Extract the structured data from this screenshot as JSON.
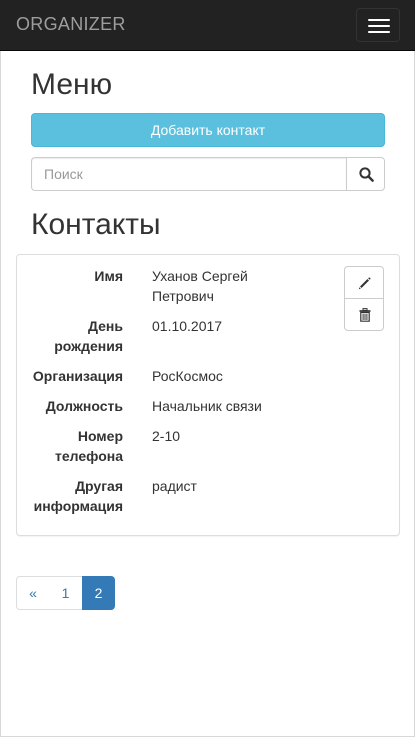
{
  "navbar": {
    "brand": "ORGANIZER",
    "toggle_icon": "hamburger-icon"
  },
  "menu": {
    "title": "Меню",
    "add_button_label": "Добавить контакт",
    "search_placeholder": "Поиск",
    "search_value": "",
    "search_icon": "search-icon"
  },
  "contacts": {
    "title": "Контакты",
    "card": {
      "fields": [
        {
          "label_lines": [
            "Имя"
          ],
          "value_lines": [
            "Уханов Сергей",
            "Петрович"
          ]
        },
        {
          "label_lines": [
            "День",
            "рождения"
          ],
          "value_lines": [
            "01.10.2017"
          ]
        },
        {
          "label_lines": [
            "Организация"
          ],
          "value_lines": [
            "РосКосмос"
          ]
        },
        {
          "label_lines": [
            "Должность"
          ],
          "value_lines": [
            "Начальник связи"
          ]
        },
        {
          "label_lines": [
            "Номер",
            "телефона"
          ],
          "value_lines": [
            "2-10"
          ]
        },
        {
          "label_lines": [
            "Другая",
            "информация"
          ],
          "value_lines": [
            "радист"
          ]
        }
      ],
      "edit_icon": "pencil-icon",
      "delete_icon": "trash-icon"
    }
  },
  "pagination": {
    "prev_label": "«",
    "pages": [
      "1",
      "2"
    ],
    "active_page": "2"
  },
  "colors": {
    "navbar_bg": "#222222",
    "brand_text": "#9d9d9d",
    "info_button": "#5bc0de",
    "link": "#337ab7",
    "active_page_bg": "#337ab7"
  }
}
